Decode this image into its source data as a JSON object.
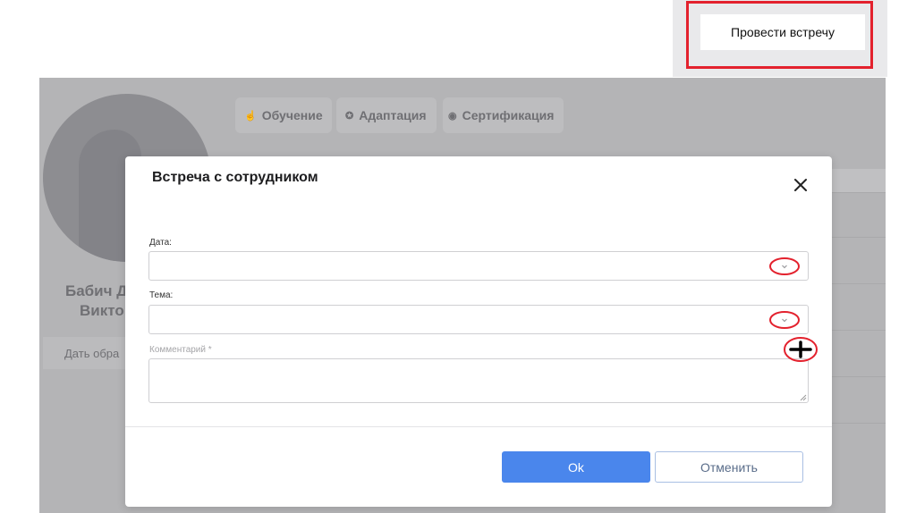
{
  "top_action": {
    "label": "Провести встречу",
    "highlight_color": "#e3212d"
  },
  "background": {
    "tabs": [
      {
        "icon": "graduation-cap-icon",
        "label": "Обучение"
      },
      {
        "icon": "adaptation-icon",
        "label": "Адаптация"
      },
      {
        "icon": "certificate-icon",
        "label": "Сертификация"
      }
    ],
    "employee_name_line1": "Бабич Д",
    "employee_name_line2": "Викто",
    "feedback_label": "Дать обра"
  },
  "modal": {
    "title": "Встреча с сотрудником",
    "date": {
      "label": "Дата:",
      "value": ""
    },
    "topic": {
      "label": "Тема:",
      "value": ""
    },
    "comment": {
      "placeholder": "Комментарий *",
      "value": ""
    },
    "ok_label": "Ok",
    "cancel_label": "Отменить",
    "accent_color": "#4a86ec",
    "annotation_color": "#e3212d"
  }
}
